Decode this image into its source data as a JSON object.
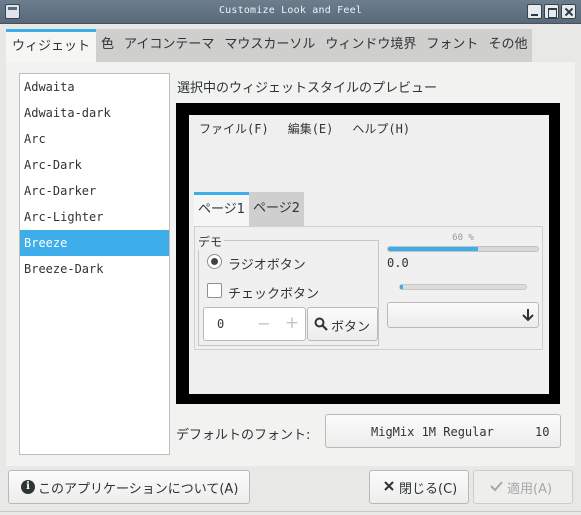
{
  "window": {
    "title": "Customize Look and Feel"
  },
  "tabs": [
    {
      "label": "ウィジェット",
      "active": true
    },
    {
      "label": "色",
      "active": false
    },
    {
      "label": "アイコンテーマ",
      "active": false
    },
    {
      "label": "マウスカーソル",
      "active": false
    },
    {
      "label": "ウィンドウ境界",
      "active": false
    },
    {
      "label": "フォント",
      "active": false
    },
    {
      "label": "その他",
      "active": false
    }
  ],
  "themes": {
    "items": [
      "Adwaita",
      "Adwaita-dark",
      "Arc",
      "Arc-Dark",
      "Arc-Darker",
      "Arc-Lighter",
      "Breeze",
      "Breeze-Dark"
    ],
    "selected": "Breeze"
  },
  "preview": {
    "label": "選択中のウィジェットスタイルのプレビュー",
    "menu": [
      "ファイル(F)",
      "編集(E)",
      "ヘルプ(H)"
    ],
    "tabs": [
      "ページ1",
      "ページ2"
    ],
    "demo_label": "デモ",
    "radio_label": "ラジオボタン",
    "radio_checked": true,
    "check_label": "チェックボタン",
    "check_checked": false,
    "spin_value": "0",
    "spin_minus": "−",
    "spin_plus": "+",
    "button_label": "ボタン",
    "progress_text": "60 %",
    "progress_fraction": 0.6,
    "scale_value": "0.0",
    "scale_fraction": 0.0
  },
  "font": {
    "label": "デフォルトのフォント:",
    "name": "MigMix 1M Regular",
    "size": "10"
  },
  "buttons": {
    "about": "このアプリケーションについて(A)",
    "close": "閉じる(C)",
    "apply": "適用(A)"
  },
  "colors": {
    "accent": "#3daee9",
    "titlebar": "#5e6f80"
  }
}
